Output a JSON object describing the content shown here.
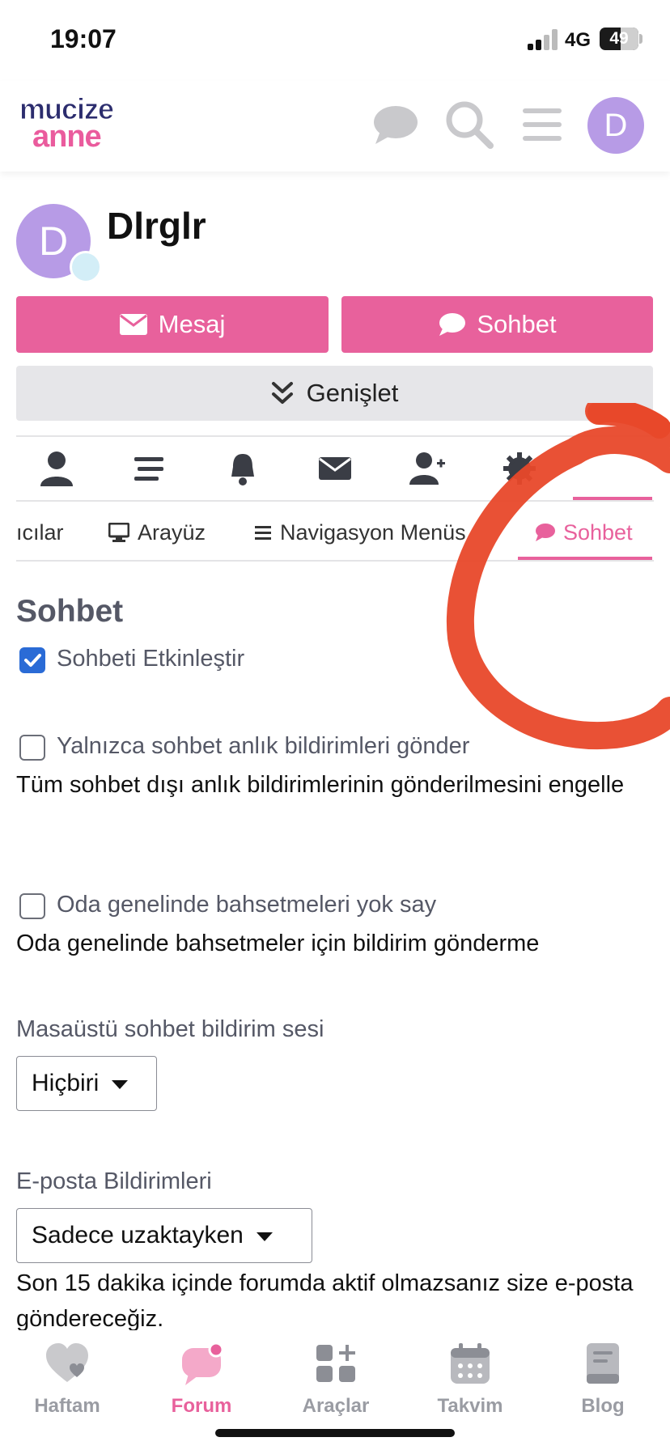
{
  "status_bar": {
    "time": "19:07",
    "network": "4G",
    "battery": "49"
  },
  "header": {
    "logo_top": "mucize",
    "logo_bottom": "anne",
    "avatar_initial": "D"
  },
  "profile": {
    "avatar_initial": "D",
    "username": "Dlrglr",
    "message_button": "Mesaj",
    "chat_button": "Sohbet",
    "expand_button": "Genişlet"
  },
  "icon_tabs": [
    "user-icon",
    "list-icon",
    "bell-icon",
    "envelope-icon",
    "user-plus-icon",
    "gear-icon"
  ],
  "text_tabs": [
    {
      "label": "ıcılar"
    },
    {
      "label": "Arayüz",
      "icon": "desktop-icon"
    },
    {
      "label": "Navigasyon Menüs",
      "icon": "list-icon"
    },
    {
      "label": "Sohbet",
      "icon": "chat-icon",
      "active": true
    }
  ],
  "content": {
    "title": "Sohbet",
    "enable_chat": {
      "label": "Sohbeti Etkinleştir",
      "checked": true
    },
    "only_chat_push": {
      "label": "Yalnızca sohbet anlık bildirimleri gönder",
      "checked": false,
      "description": "Tüm sohbet dışı anlık bildirimlerinin gönderilmesini engelle"
    },
    "ignore_channel_mentions": {
      "label": "Oda genelinde bahsetmeleri yok say",
      "checked": false,
      "description": "Oda genelinde bahsetmeler için bildirim gönderme"
    },
    "desktop_sound": {
      "label": "Masaüstü sohbet bildirim sesi",
      "value": "Hiçbiri"
    },
    "email_notifications": {
      "label": "E-posta Bildirimleri",
      "value": "Sadece uzaktayken",
      "description": "Son 15 dakika içinde forumda aktif olmazsanız size e-posta göndereceğiz."
    }
  },
  "bottom_nav": [
    {
      "label": "Haftam",
      "icon": "heart-icon"
    },
    {
      "label": "Forum",
      "icon": "chat-bubble-icon",
      "active": true
    },
    {
      "label": "Araçlar",
      "icon": "grid-plus-icon"
    },
    {
      "label": "Takvim",
      "icon": "calendar-icon"
    },
    {
      "label": "Blog",
      "icon": "book-icon"
    }
  ],
  "colors": {
    "accent": "#e8619c",
    "avatar": "#b79be6",
    "checkbox": "#2a6bd6",
    "annotation": "#e8482a"
  }
}
